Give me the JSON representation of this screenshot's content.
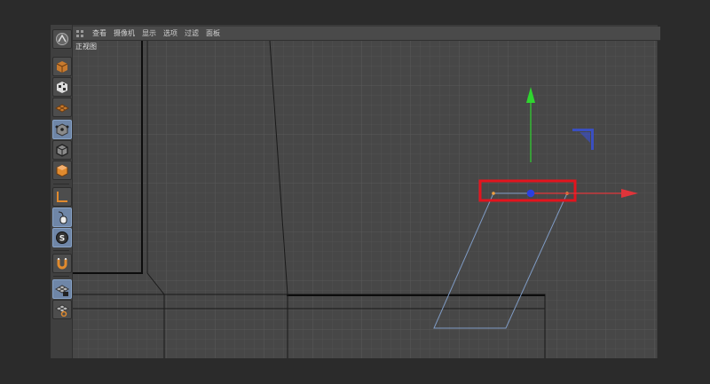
{
  "menu": {
    "items": [
      "查看",
      "摄像机",
      "显示",
      "选项",
      "过滤",
      "面板"
    ]
  },
  "viewport": {
    "label": "正视图"
  },
  "toolbar": {
    "tools": [
      {
        "name": "cinema4d-logo-icon",
        "active": false
      },
      {
        "name": "model-mode-cube-icon",
        "active": false
      },
      {
        "name": "texture-mode-icon",
        "active": false
      },
      {
        "name": "workplane-mode-icon",
        "active": false
      },
      {
        "name": "points-mode-icon",
        "active": true
      },
      {
        "name": "edges-mode-icon",
        "active": false
      },
      {
        "name": "polygons-mode-icon",
        "active": false
      },
      {
        "name": "axis-mode-icon",
        "active": false
      },
      {
        "name": "tweak-mode-icon",
        "active": true
      },
      {
        "name": "solo-mode-icon",
        "active": true
      },
      {
        "name": "snap-magnet-icon",
        "active": false
      },
      {
        "name": "lock-workplane-icon",
        "active": true
      },
      {
        "name": "planar-workplane-icon",
        "active": false
      }
    ]
  },
  "colors": {
    "axis_x": "#e0343a",
    "axis_y": "#2fd52f",
    "axis_z": "#3a4fc0",
    "selection_box": "#e3141e",
    "polygon_edge": "#7f9bc4",
    "point": "#f0a040",
    "handle": "#2a3fe0"
  }
}
